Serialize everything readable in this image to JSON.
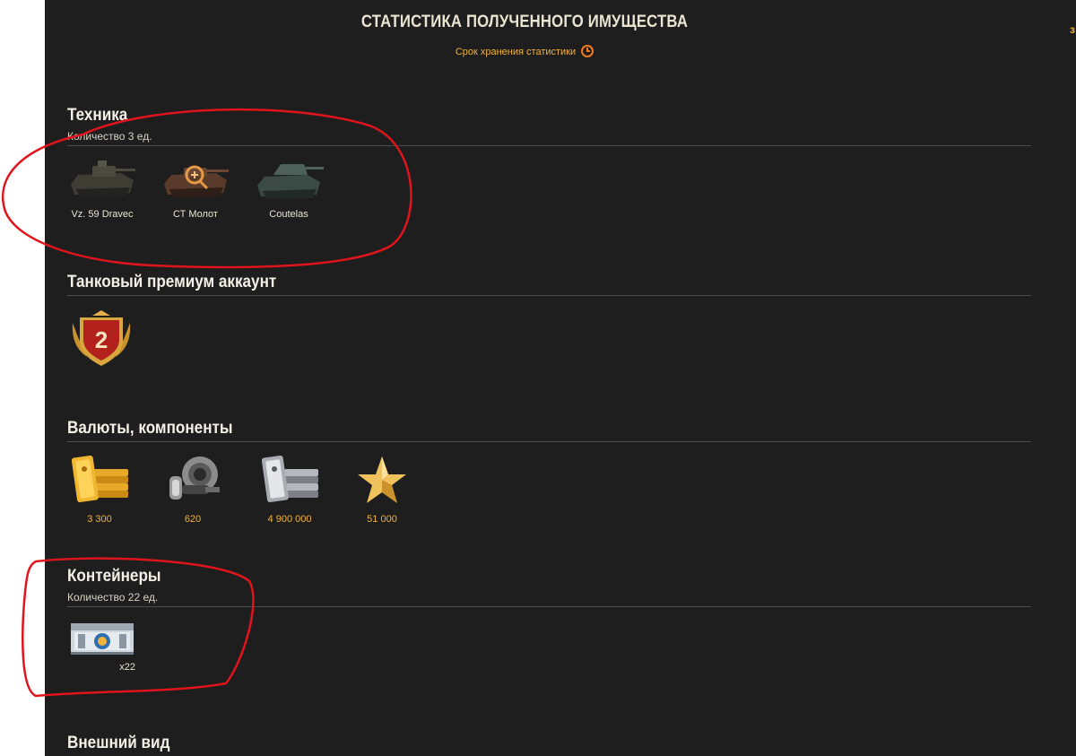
{
  "header": {
    "title": "СТАТИСТИКА ПОЛУЧЕННОГО ИМУЩЕСТВА",
    "storage_label": "Срок хранения статистики",
    "edge_fragment": "з"
  },
  "sections": {
    "vehicles": {
      "title": "Техника",
      "count": "Количество 3 ед.",
      "items": [
        {
          "name": "Vz. 59 Dravec",
          "icon": "tank-icon"
        },
        {
          "name": "СТ Молот",
          "icon": "tank-icon"
        },
        {
          "name": "Coutelas",
          "icon": "tank-icon"
        }
      ]
    },
    "premium": {
      "title": "Танковый премиум аккаунт",
      "badge_value": "2",
      "icon": "premium-badge-icon"
    },
    "currencies": {
      "title": "Валюты, компоненты",
      "items": [
        {
          "value": "3 300",
          "icon": "gold-icon"
        },
        {
          "value": "620",
          "icon": "equipment-parts-icon"
        },
        {
          "value": "4 900 000",
          "icon": "credits-icon"
        },
        {
          "value": "51 000",
          "icon": "free-xp-star-icon"
        }
      ]
    },
    "containers": {
      "title": "Контейнеры",
      "count": "Количество 22 ед.",
      "items": [
        {
          "quantity": "x22",
          "icon": "container-crate-icon"
        }
      ]
    },
    "appearance": {
      "title": "Внешний вид"
    }
  },
  "colors": {
    "background": "#1e1e1f",
    "gold_text": "#f2b23b",
    "annotation": "#e0141c"
  }
}
